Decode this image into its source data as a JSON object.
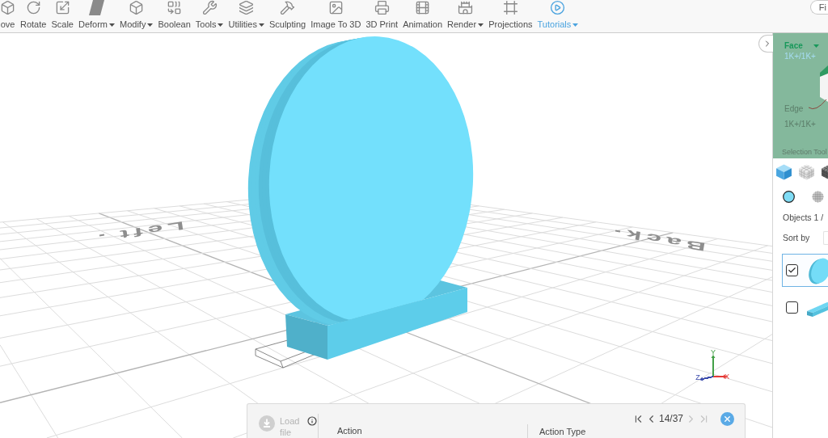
{
  "toolbar": {
    "items": [
      {
        "label": "ove",
        "dropdown": false,
        "highlighted": false
      },
      {
        "label": "Rotate",
        "dropdown": false,
        "highlighted": false
      },
      {
        "label": "Scale",
        "dropdown": false,
        "highlighted": false
      },
      {
        "label": "Deform",
        "dropdown": true,
        "highlighted": false
      },
      {
        "label": "Modify",
        "dropdown": true,
        "highlighted": false
      },
      {
        "label": "Boolean",
        "dropdown": false,
        "highlighted": false
      },
      {
        "label": "Tools",
        "dropdown": true,
        "highlighted": false
      },
      {
        "label": "Utilities",
        "dropdown": true,
        "highlighted": false
      },
      {
        "label": "Sculpting",
        "dropdown": false,
        "highlighted": false
      },
      {
        "label": "Image To 3D",
        "dropdown": false,
        "highlighted": false
      },
      {
        "label": "3D Print",
        "dropdown": false,
        "highlighted": false
      },
      {
        "label": "Animation",
        "dropdown": false,
        "highlighted": false
      },
      {
        "label": "Render",
        "dropdown": true,
        "highlighted": false
      },
      {
        "label": "Projections",
        "dropdown": false,
        "highlighted": false
      },
      {
        "label": "Tutorials",
        "dropdown": true,
        "highlighted": true
      }
    ],
    "search_button": {
      "label": "Fi"
    }
  },
  "viewport": {
    "floor_labels": [
      "Left",
      "Back"
    ],
    "axes": [
      {
        "kind": "x",
        "label": "X",
        "color": "#e53935"
      },
      {
        "kind": "y",
        "label": "Y",
        "color": "#43a047"
      },
      {
        "kind": "z",
        "label": "Z",
        "color": "#3949ab"
      }
    ]
  },
  "history_panel": {
    "load_button": {
      "label": "Load file",
      "disabled": true
    },
    "nav_buttons": [
      {
        "kind": "first",
        "disabled": false
      },
      {
        "kind": "previous",
        "disabled": false
      },
      {
        "kind": "next",
        "disabled": true
      },
      {
        "kind": "last",
        "disabled": true
      }
    ],
    "page": "14/37",
    "columns": [
      "Action",
      "Action Type"
    ]
  },
  "side_panel": {
    "selection": {
      "mode": "Face",
      "mode_count": "1K+/1K+",
      "secondary_mode": "Edge",
      "secondary_count": "1K+/1K+",
      "caption": "Selection Tool"
    },
    "display_modes": [
      {
        "kind": "solid",
        "selected": true
      },
      {
        "kind": "wireframe",
        "selected": false
      },
      {
        "kind": "shaded",
        "selected": false
      }
    ],
    "objects_label": "Objects 1 /",
    "sort_label": "Sort by",
    "objects": [
      {
        "kind": "disc",
        "checked": true,
        "selected": true
      },
      {
        "kind": "slab",
        "checked": false,
        "selected": false
      }
    ]
  }
}
